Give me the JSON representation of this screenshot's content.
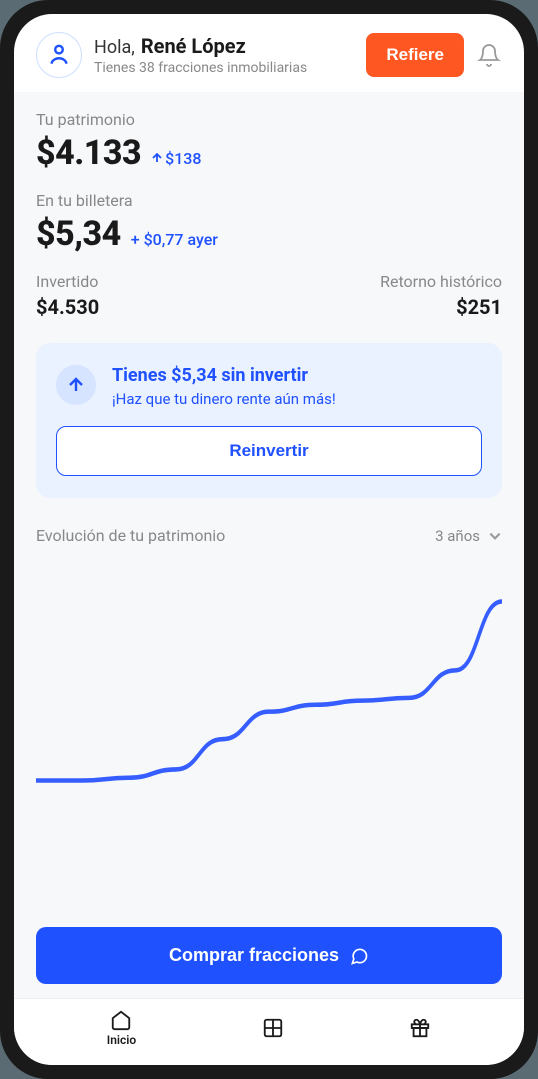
{
  "header": {
    "hello": "Hola,",
    "user_name": "René López",
    "subtitle": "Tienes 38 fracciones inmobiliarias",
    "refer_label": "Refiere"
  },
  "patrimony": {
    "label": "Tu patrimonio",
    "amount": "$4.133",
    "delta": "$138"
  },
  "wallet": {
    "label": "En tu billetera",
    "amount": "$5,34",
    "delta": "+ $0,77 ayer"
  },
  "invested": {
    "label": "Invertido",
    "amount": "$4.530"
  },
  "return": {
    "label": "Retorno histórico",
    "amount": "$251"
  },
  "reinvest": {
    "title": "Tienes $5,34 sin invertir",
    "subtitle": "¡Haz que tu dinero rente aún más!",
    "button": "Reinvertir"
  },
  "evolution": {
    "title": "Evolución de tu patrimonio",
    "period": "3 años"
  },
  "chart_data": {
    "type": "line",
    "x": [
      0,
      1,
      2,
      3,
      4,
      5,
      6,
      7,
      8,
      9,
      10
    ],
    "values": [
      100,
      100,
      102,
      108,
      130,
      150,
      155,
      158,
      160,
      180,
      230
    ],
    "title": "Evolución de tu patrimonio",
    "xlabel": "",
    "ylabel": "",
    "ylim": [
      80,
      250
    ]
  },
  "cta": {
    "buy": "Comprar fracciones"
  },
  "nav": {
    "home": "Inicio"
  }
}
